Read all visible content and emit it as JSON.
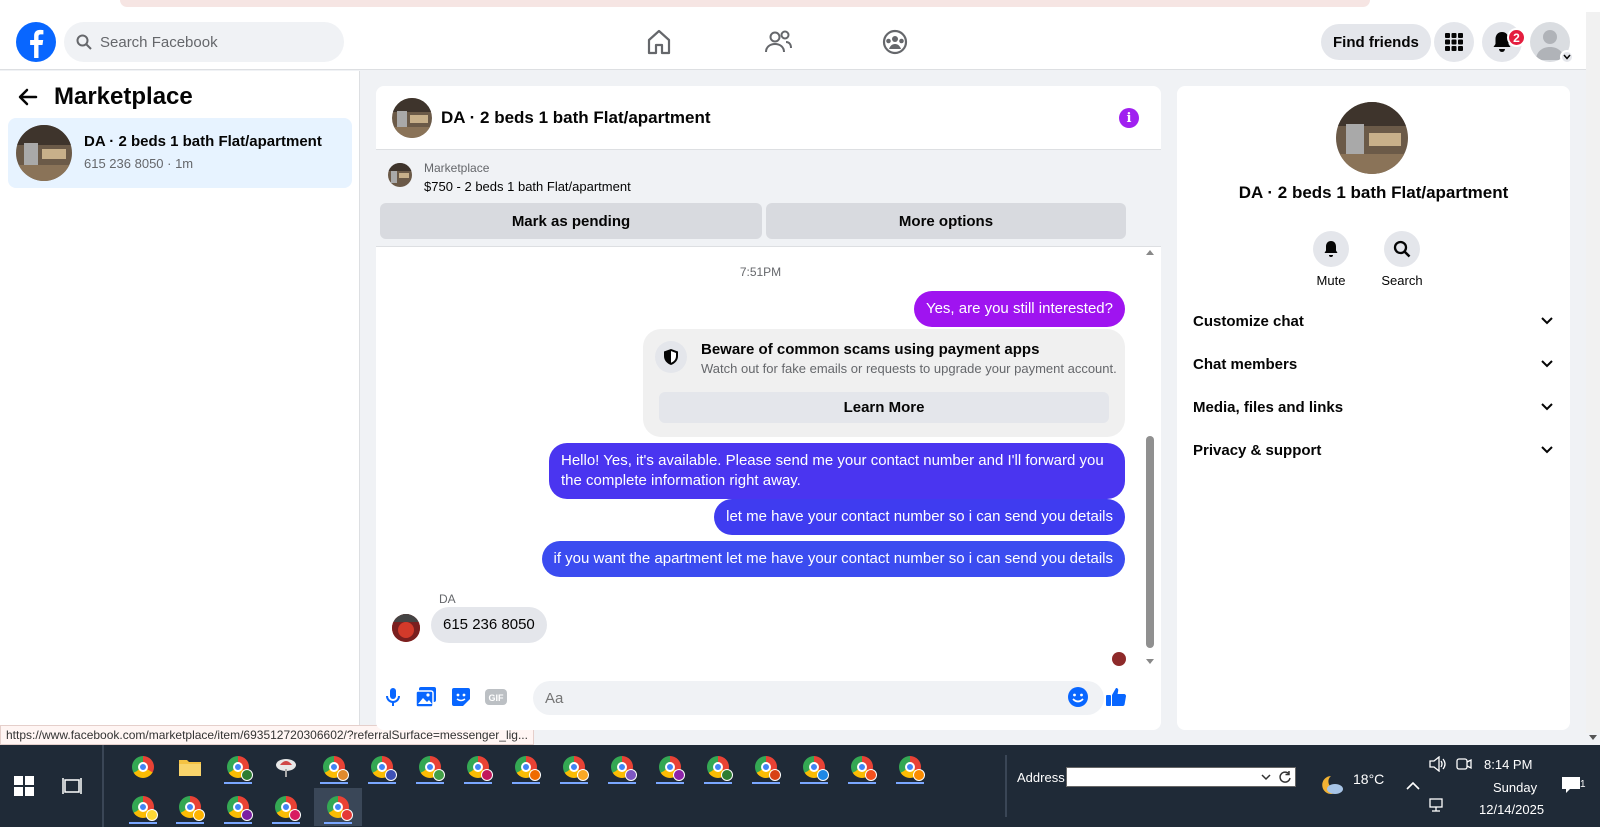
{
  "header": {
    "search_placeholder": "Search Facebook",
    "find_friends_label": "Find friends",
    "notification_count": "2"
  },
  "sidebar": {
    "title": "Marketplace",
    "conversation": {
      "name": "DA · 2 beds 1 bath Flat/apartment",
      "subtitle": "615 236 8050 · 1m"
    }
  },
  "chat": {
    "title": "DA · 2 beds 1 bath Flat/apartment",
    "listing": {
      "label": "Marketplace",
      "description": "$750 - 2 beds 1 bath Flat/apartment",
      "mark_pending_label": "Mark as pending",
      "more_options_label": "More options"
    },
    "timestamp": "7:51PM",
    "messages_out": [
      "Yes, are you still interested?",
      "Hello! Yes, it's available. Please send me your contact number and I'll forward you the complete information right away.",
      "let me have your contact number so i can send you details",
      "if you want the apartment let me have your contact number so i can send you details"
    ],
    "scam_notice": {
      "heading": "Beware of common scams using payment apps",
      "text": "Watch out for fake emails or requests to upgrade your payment account.",
      "button": "Learn More"
    },
    "incoming": {
      "sender": "DA",
      "text": "615 236 8050"
    },
    "composer_placeholder": "Aa",
    "gif_label": "GIF"
  },
  "details": {
    "name": "DA · 2 beds 1 bath Flat/apartment",
    "mute_label": "Mute",
    "search_label": "Search",
    "sections": [
      "Customize chat",
      "Chat members",
      "Media, files and links",
      "Privacy & support"
    ]
  },
  "status_url": "https://www.facebook.com/marketplace/item/693512720306602/?referralSurface=messenger_lig...",
  "taskbar": {
    "address_label": "Address",
    "temperature": "18°C",
    "time": "8:14 PM",
    "day": "Sunday",
    "date": "12/14/2025",
    "notification_count": "1"
  },
  "colors": {
    "facebook_blue": "#0866ff",
    "bubble_purple": "#9f14f0",
    "bubble_indigo": "#4a35f0",
    "bubble_blue": "#3b4cf0",
    "notification_red": "#e41e3f"
  }
}
